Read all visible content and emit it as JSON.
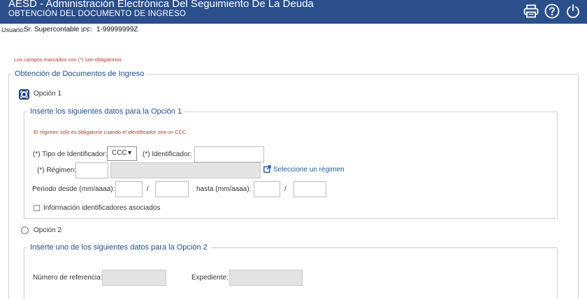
{
  "header": {
    "title": "AESD - Administración Electrónica Del Seguimiento De La Deuda",
    "subtitle": "OBTENCIÓN DEL DOCUMENTO DE INGRESO",
    "icons": [
      "printer-icon",
      "help-icon",
      "logout-icon"
    ],
    "bg_color": "#2a4f8a"
  },
  "userbar": {
    "user_label": "Usuario:",
    "user_value": "Sr. Supercontable",
    "ipf_label": "IPF:",
    "ipf_value": "1-99999999Z"
  },
  "required_note": "Los campos marcados con (*) son obligatorios",
  "main_section": {
    "legend": "Obtención de Documentos de Ingreso"
  },
  "option1": {
    "radio_label": "Opción 1",
    "selected": true,
    "legend": "Inserte los siguientes datos para la Opción 1",
    "hint": "El régimen sólo es obligatorio cuando el identificador sea un CCC.",
    "tipo_label": "(*) Tipo de Identificador:",
    "tipo_value": "CCC",
    "identificador_label": "(*) Identificador:",
    "identificador_value": "",
    "regimen_label": "(*) Régimen:",
    "regimen_code": "",
    "regimen_desc": "",
    "regimen_link": "Seleccione un régimen",
    "periodo_desde_label": "Periodo desde (mm/aaaa):",
    "hasta_label": "hasta (mm/aaaa):",
    "slash": "/",
    "desde_mm": "",
    "desde_aaaa": "",
    "hasta_mm": "",
    "hasta_aaaa": "",
    "asociados_label": "Información identificadores asociados",
    "asociados_checked": false
  },
  "option2": {
    "radio_label": "Opción 2",
    "selected": false,
    "legend": "Inserte uno de los siguientes datos para la Opción 2",
    "referencia_label": "Número de referencia:",
    "referencia_value": "",
    "expediente_label": "Expediente:",
    "expediente_value": ""
  }
}
